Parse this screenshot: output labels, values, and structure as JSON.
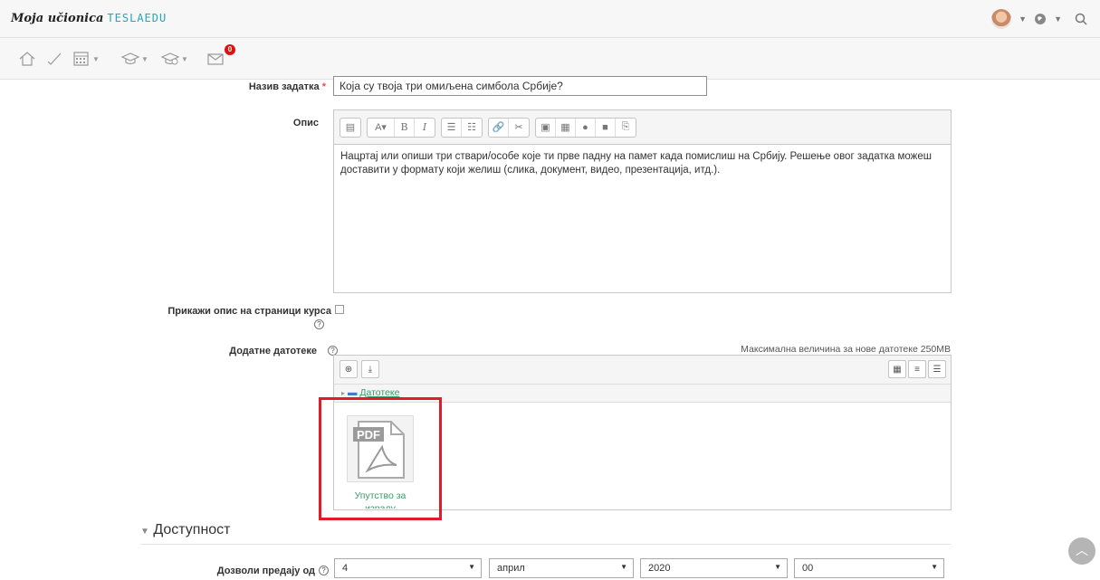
{
  "header": {
    "brand_part1": "Moja učionica",
    "brand_part2": "TESLAEDU"
  },
  "iconbar": {
    "notification_count": "0"
  },
  "form": {
    "name_label": "Назив задатка",
    "name_required": "*",
    "name_value": "Која су твоја три омиљена симбола Србије?",
    "desc_label": "Опис",
    "desc_text": "Нацртај или опиши три ствари/особе које ти прве падну на памет када помислиш на Србију. Решење овог задатка можеш доставити у формату који желиш (слика, документ, видео, презентација, итд.).",
    "show_desc_label": "Прикажи опис на страници курса",
    "files_label": "Додатне датотеке",
    "max_size": "Максимална величина за нове датотеке 250MB",
    "folder": "Датотеке",
    "file_name_1": "Упутство за",
    "file_name_2": "израду",
    "file_type": "PDF"
  },
  "availability": {
    "section_title": "Доступност",
    "allow_label": "Дозволи предају од",
    "day": "4",
    "month": "април",
    "year": "2020",
    "hour": "00"
  }
}
